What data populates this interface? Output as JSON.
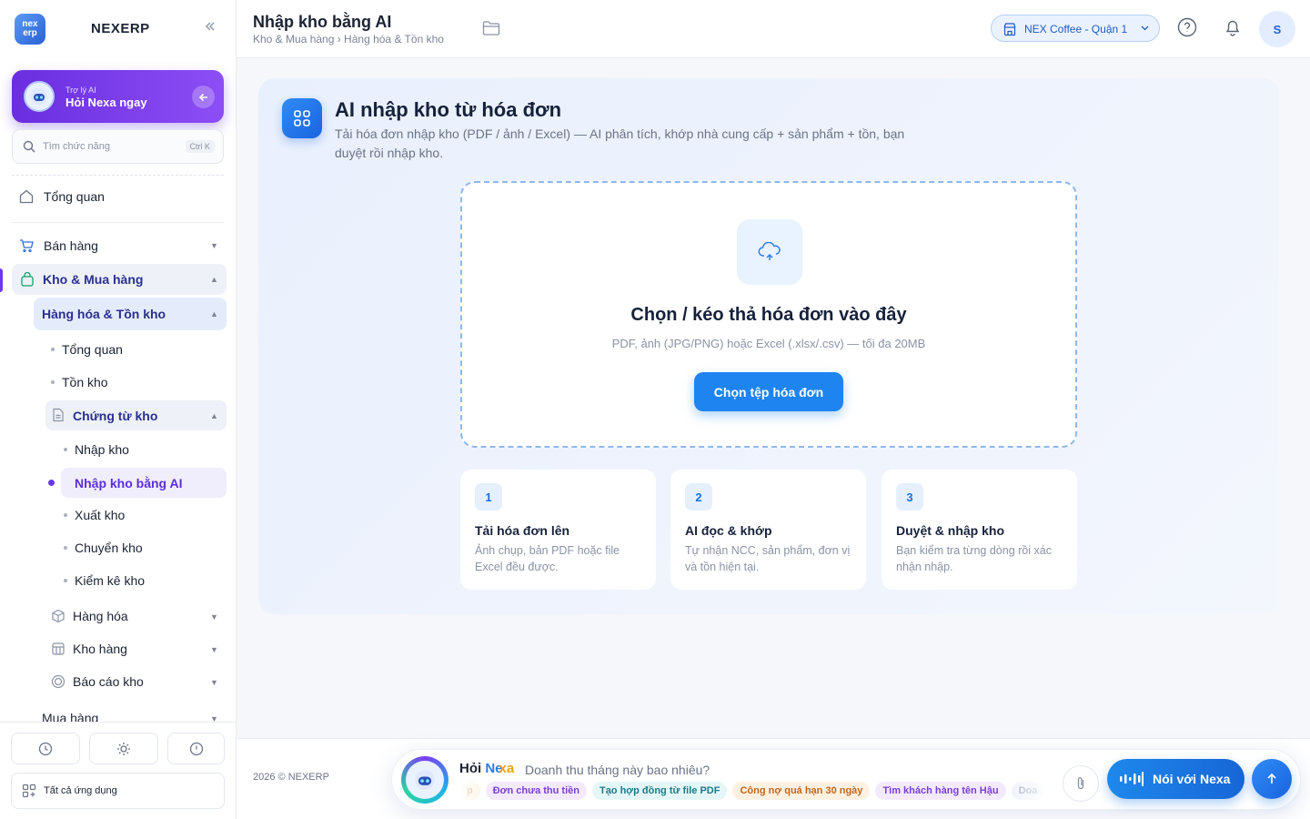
{
  "brand": {
    "name": "NEXERP",
    "logo_top": "nex",
    "logo_bottom": "erp"
  },
  "ai_card": {
    "subtitle": "Trợ lý AI",
    "title": "Hỏi Nexa ngay"
  },
  "search": {
    "placeholder": "Tìm chức năng",
    "shortcut": "Ctrl K"
  },
  "nav": {
    "overview": "Tổng quan",
    "sales": "Bán hàng",
    "warehouse": "Kho & Mua hàng",
    "goods_stock": "Hàng hóa & Tồn kho",
    "sub_overview": "Tổng quan",
    "stock": "Tồn kho",
    "vouchers": "Chứng từ kho",
    "import": "Nhập kho",
    "import_ai": "Nhập kho bằng AI",
    "export": "Xuất kho",
    "transfer": "Chuyển kho",
    "stocktake": "Kiểm kê kho",
    "goods": "Hàng hóa",
    "storehouse": "Kho hàng",
    "reports": "Báo cáo kho",
    "purchasing": "Mua hàng"
  },
  "bottom": {
    "all_apps": "Tất cả ứng dụng"
  },
  "header": {
    "title": "Nhập kho bằng AI",
    "breadcrumb": "Kho & Mua hàng › Hàng hóa & Tồn kho",
    "store": "NEX Coffee - Quận 1",
    "avatar": "S"
  },
  "main": {
    "title": "AI nhập kho từ hóa đơn",
    "description": "Tải hóa đơn nhập kho (PDF / ảnh / Excel) — AI phân tích, khớp nhà cung cấp + sản phẩm + tồn, bạn duyệt rồi nhập kho.",
    "drop_title": "Chọn / kéo thả hóa đơn vào đây",
    "drop_sub": "PDF, ảnh (JPG/PNG) hoặc Excel (.xlsx/.csv) — tối đa 20MB",
    "pick_button": "Chọn tệp hóa đơn",
    "steps": [
      {
        "num": "1",
        "title": "Tải hóa đơn lên",
        "desc": "Ảnh chụp, bản PDF hoặc file Excel đều được."
      },
      {
        "num": "2",
        "title": "AI đọc & khớp",
        "desc": "Tự nhận NCC, sản phẩm, đơn vị và tồn hiện tại."
      },
      {
        "num": "3",
        "title": "Duyệt & nhập kho",
        "desc": "Bạn kiểm tra từng dòng rồi xác nhận nhập."
      }
    ]
  },
  "footer": {
    "copyright": "2026 © NEXERP"
  },
  "chat": {
    "ask_prefix": "Hỏi",
    "ask_name_a": "Ne",
    "ask_name_b": "xa",
    "placeholder": "Doanh thu tháng này bao nhiêu?",
    "chips": [
      "p",
      "Đơn chưa thu tiền",
      "Tạo hợp đồng từ file PDF",
      "Công nợ quá hạn 30 ngày",
      "Tìm khách hàng tên Hậu",
      "Doa"
    ],
    "voice_button": "Nói với Nexa"
  },
  "colors": {
    "accent": "#1e84f0",
    "brand_purple": "#6a38e8",
    "sidebar_active_bg": "#f0edfc"
  }
}
